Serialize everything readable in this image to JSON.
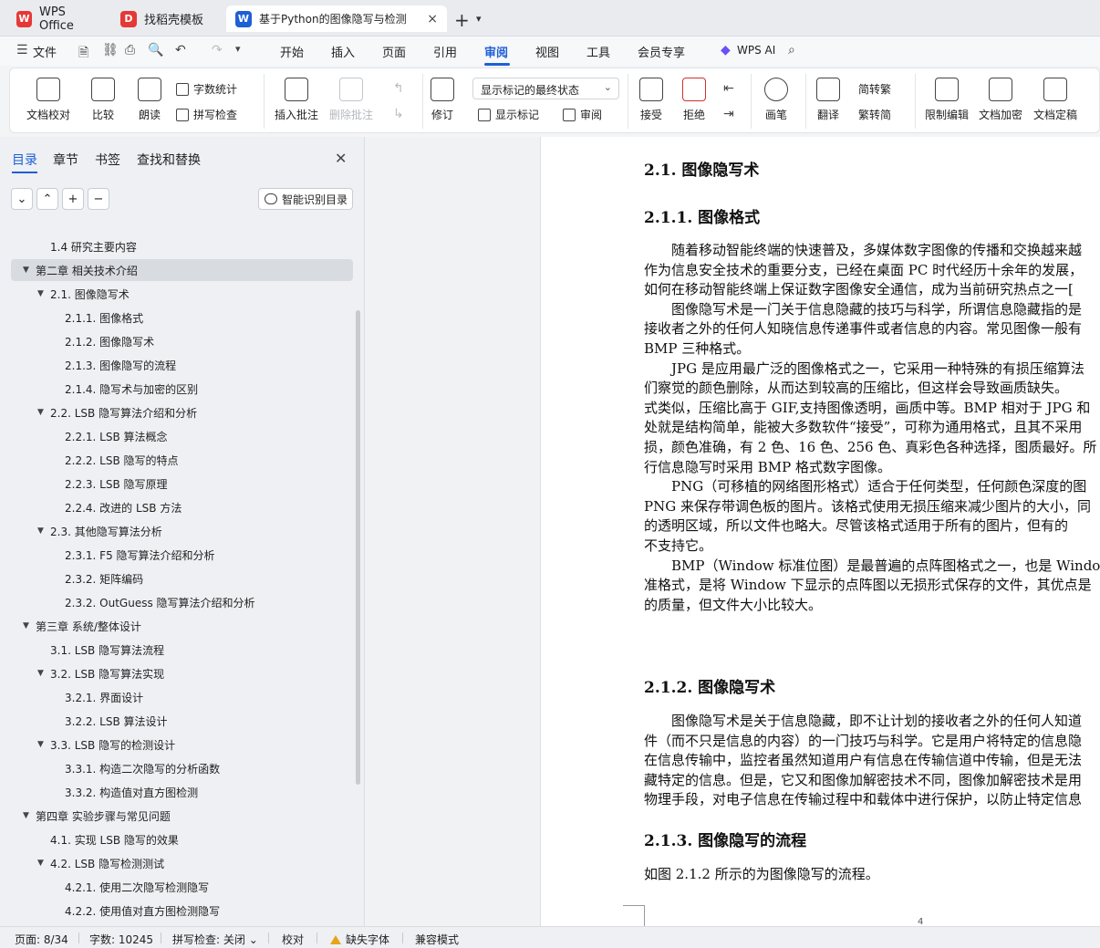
{
  "tabs": [
    {
      "label": "WPS Office",
      "icon": "wps-logo-icon",
      "color": "#e53935"
    },
    {
      "label": "找稻壳模板",
      "icon": "docer-icon",
      "color": "#e53935"
    },
    {
      "label": "基于Python的图像隐写与检测",
      "icon": "wps-writer-icon",
      "color": "#1e5fd6"
    }
  ],
  "menubar": {
    "file_label": "文件",
    "items": [
      "开始",
      "插入",
      "页面",
      "引用",
      "审阅",
      "视图",
      "工具",
      "会员专享"
    ],
    "active": "审阅",
    "ai_label": "WPS AI"
  },
  "ribbon": {
    "doc_check": "文档校对",
    "compare": "比较",
    "read_aloud": "朗读",
    "word_count": "字数统计",
    "spell_check": "拼写检查",
    "insert_comment": "插入批注",
    "delete_comment": "删除批注",
    "track": "修订",
    "markup_state": "显示标记的最终状态",
    "show_markup": "显示标记",
    "review": "审阅",
    "accept": "接受",
    "reject": "拒绝",
    "draw": "画笔",
    "translate": "翻译",
    "to_traditional": "简转繁",
    "to_simplified": "繁转简",
    "restrict_edit": "限制编辑",
    "encrypt": "文档加密",
    "finalize": "文档定稿"
  },
  "nav": {
    "tabs": [
      "目录",
      "章节",
      "书签",
      "查找和替换"
    ],
    "smart_toc": "智能识别目录",
    "toc": [
      {
        "label": "1.4 研究主要内容",
        "level": 1
      },
      {
        "label": "第二章  相关技术介绍",
        "level": 0,
        "expanded": true,
        "selected": true
      },
      {
        "label": "2.1.  图像隐写术",
        "level": 1,
        "expanded": true
      },
      {
        "label": "2.1.1.  图像格式",
        "level": 2
      },
      {
        "label": "2.1.2.  图像隐写术",
        "level": 2
      },
      {
        "label": "2.1.3.  图像隐写的流程",
        "level": 2
      },
      {
        "label": "2.1.4.  隐写术与加密的区别",
        "level": 2
      },
      {
        "label": "2.2. LSB 隐写算法介绍和分析",
        "level": 1,
        "expanded": true
      },
      {
        "label": "2.2.1. LSB 算法概念",
        "level": 2
      },
      {
        "label": "2.2.2. LSB 隐写的特点",
        "level": 2
      },
      {
        "label": "2.2.3. LSB 隐写原理",
        "level": 2
      },
      {
        "label": "2.2.4.  改进的 LSB 方法",
        "level": 2
      },
      {
        "label": "2.3.  其他隐写算法分析",
        "level": 1,
        "expanded": true
      },
      {
        "label": "2.3.1. F5 隐写算法介绍和分析",
        "level": 2
      },
      {
        "label": "2.3.2.  矩阵编码",
        "level": 2
      },
      {
        "label": "2.3.2. OutGuess 隐写算法介绍和分析",
        "level": 2
      },
      {
        "label": "第三章  系统/整体设计",
        "level": 0,
        "expanded": true
      },
      {
        "label": "3.1. LSB 隐写算法流程",
        "level": 1
      },
      {
        "label": "3.2. LSB 隐写算法实现",
        "level": 1,
        "expanded": true
      },
      {
        "label": "3.2.1.  界面设计",
        "level": 2
      },
      {
        "label": "3.2.2. LSB 算法设计",
        "level": 2
      },
      {
        "label": "3.3. LSB 隐写的检测设计",
        "level": 1,
        "expanded": true
      },
      {
        "label": "3.3.1.  构造二次隐写的分析函数",
        "level": 2
      },
      {
        "label": "3.3.2.  构造值对直方图检测",
        "level": 2
      },
      {
        "label": "第四章  实验步骤与常见问题",
        "level": 0,
        "expanded": true
      },
      {
        "label": "4.1.  实现 LSB 隐写的效果",
        "level": 1
      },
      {
        "label": "4.2. LSB 隐写检测测试",
        "level": 1,
        "expanded": true
      },
      {
        "label": "4.2.1.  使用二次隐写检测隐写",
        "level": 2
      },
      {
        "label": "4.2.2.  使用值对直方图检测隐写",
        "level": 2
      }
    ]
  },
  "doc": {
    "h_2_1": "2.1.  图像隐写术",
    "h_2_1_1": "2.1.1.  图像格式",
    "p1": [
      "　　随着移动智能终端的快速普及，多媒体数字图像的传播和交换越来越",
      "作为信息安全技术的重要分支，已经在桌面 PC 时代经历十余年的发展，",
      "如何在移动智能终端上保证数字图像安全通信，成为当前研究热点之一["
    ],
    "p2": [
      "　　图像隐写术是一门关于信息隐藏的技巧与科学，所谓信息隐藏指的是",
      "接收者之外的任何人知晓信息传递事件或者信息的内容。常见图像一般有",
      "BMP 三种格式。"
    ],
    "p3": [
      "　　JPG 是应用最广泛的图像格式之一，它采用一种特殊的有损压缩算法",
      "们察觉的颜色删除，从而达到较高的压缩比，但这样会导致画质缺失。",
      "式类似，压缩比高于 GIF,支持图像透明，画质中等。BMP 相对于 JPG 和",
      "处就是结构简单，能被大多数软件“接受”，可称为通用格式，且其不采用",
      "损，颜色准确，有 2 色、16 色、256 色、真彩色各种选择，图质最好。所",
      "行信息隐写时采用 BMP 格式数字图像。"
    ],
    "p4": [
      "　　PNG（可移植的网络图形格式）适合于任何类型，任何颜色深度的图",
      "PNG 来保存带调色板的图片。该格式使用无损压缩来减少图片的大小，同",
      "的透明区域，所以文件也略大。尽管该格式适用于所有的图片，但有的",
      "不支持它。"
    ],
    "p5": [
      "　　BMP（Window 标准位图）是最普遍的点阵图格式之一，也是 Windo",
      "准格式，是将 Window 下显示的点阵图以无损形式保存的文件，其优点是",
      "的质量，但文件大小比较大。"
    ],
    "h_2_1_2": "2.1.2.  图像隐写术",
    "p6": [
      "　　图像隐写术是关于信息隐藏，即不让计划的接收者之外的任何人知道",
      "件（而不只是信息的内容）的一门技巧与科学。它是用户将特定的信息隐",
      "在信息传输中，监控者虽然知道用户有信息在传输信道中传输，但是无法",
      "藏特定的信息。但是，它又和图像加解密技术不同，图像加解密技术是用",
      "物理手段，对电子信息在传输过程中和载体中进行保护，以防止特定信息"
    ],
    "h_2_1_3": "2.1.3.  图像隐写的流程",
    "p7": "如图 2.1.2 所示的为图像隐写的流程。",
    "page_number": "4"
  },
  "status": {
    "page": "页面: 8/34",
    "words": "字数: 10245",
    "spell": "拼写检查: 关闭",
    "proof": "校对",
    "missing_font": "缺失字体",
    "compat": "兼容模式"
  }
}
